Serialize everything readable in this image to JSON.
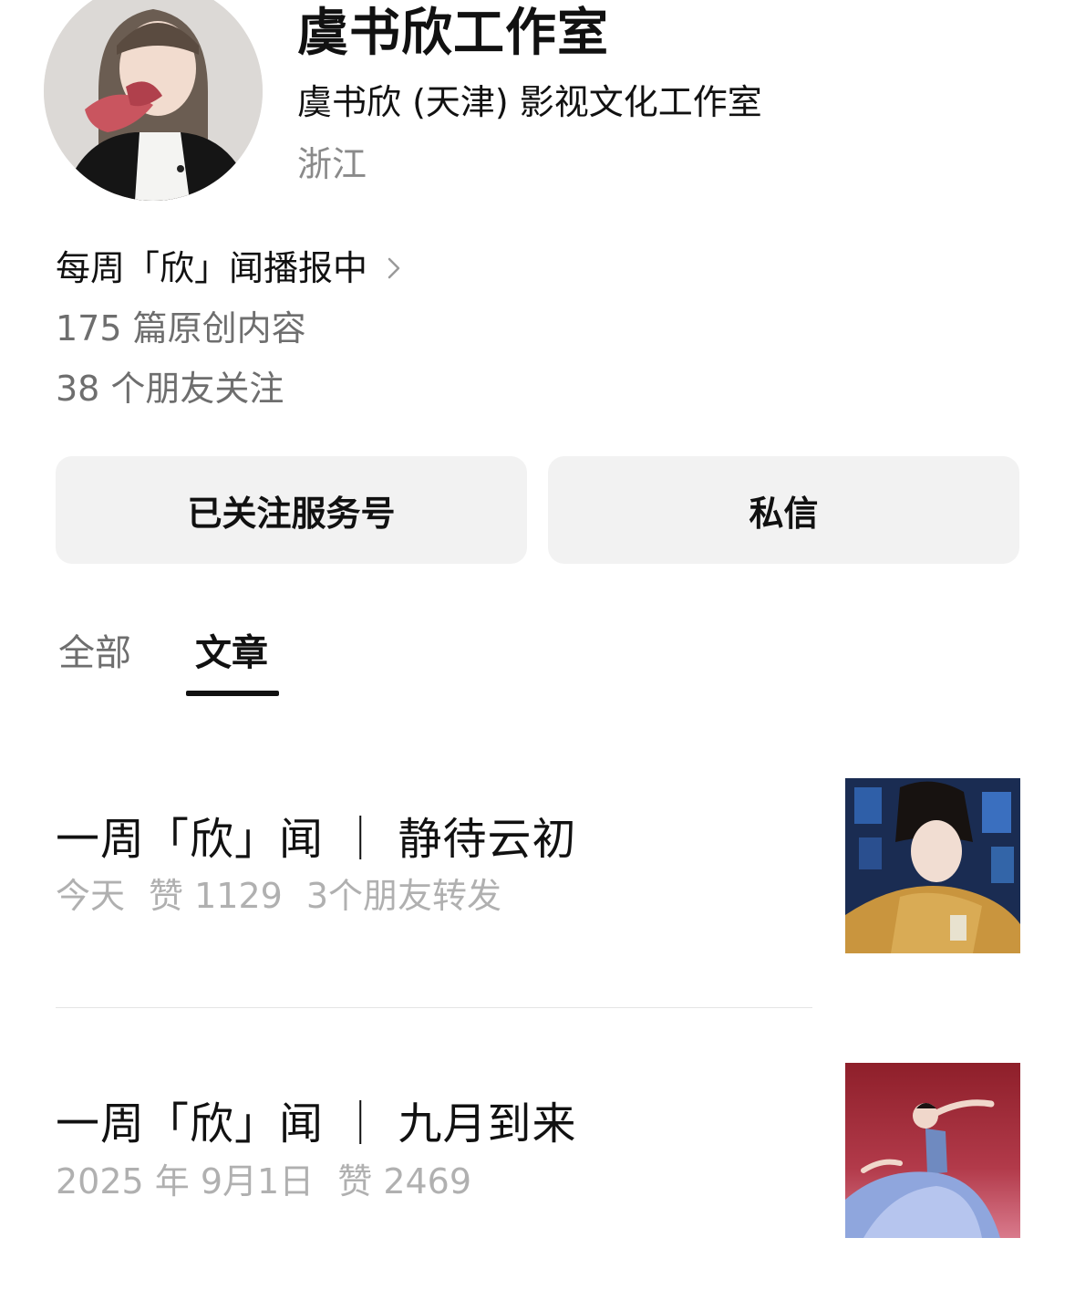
{
  "profile": {
    "name": "虞书欣工作室",
    "company": "虞书欣 (天津) 影视文化工作室",
    "location": "浙江",
    "tagline": "每周「欣」闻播报中",
    "articles_count": "175 篇原创内容",
    "friends_following": "38 个朋友关注",
    "avatar_icon": "profile-portrait"
  },
  "actions": {
    "follow_label": "已关注服务号",
    "message_label": "私信"
  },
  "tabs": [
    {
      "label": "全部",
      "active": false
    },
    {
      "label": "文章",
      "active": true
    }
  ],
  "articles": [
    {
      "title": "一周「欣」闻 ｜ 静待云初",
      "date": "今天",
      "likes": "赞 1129",
      "shares": "3个朋友转发",
      "thumbnail_icon": "photo-thumbnail"
    },
    {
      "title": "一周「欣」闻 ｜ 九月到来",
      "date": "2025 年 9月1日",
      "likes": "赞 2469",
      "thumbnail_icon": "photo-thumbnail"
    }
  ],
  "colors": {
    "primary_text": "#111111",
    "secondary_text": "#6e6e6e",
    "meta_text": "#b0b0b0",
    "button_bg": "#f2f2f2"
  }
}
